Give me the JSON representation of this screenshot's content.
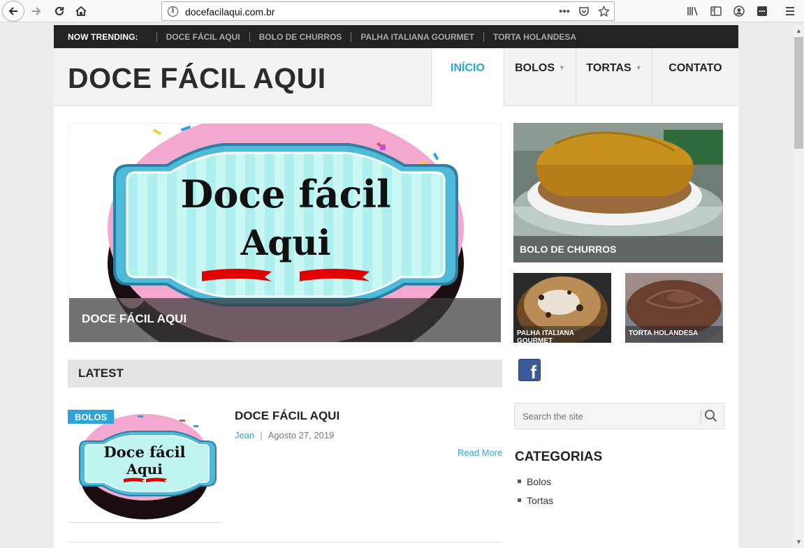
{
  "browser": {
    "url": "docefacilaqui.com.br"
  },
  "trending": {
    "label": "NOW TRENDING:",
    "links": [
      "DOCE FÁCIL AQUI",
      "BOLO DE CHURROS",
      "PALHA ITALIANA GOURMET",
      "TORTA HOLANDESA"
    ]
  },
  "site": {
    "title": "DOCE FÁCIL AQUI"
  },
  "nav": {
    "items": [
      {
        "label": "INÍCIO"
      },
      {
        "label": "BOLOS"
      },
      {
        "label": "TORTAS"
      },
      {
        "label": "CONTATO"
      }
    ]
  },
  "hero": {
    "logo_line1": "Doce fácil",
    "logo_line2": "Aqui",
    "caption": "DOCE FÁCIL AQUI"
  },
  "featured": {
    "big_caption": "BOLO DE CHURROS",
    "small1_caption": "PALHA ITALIANA GOURMET",
    "small2_caption": "TORTA HOLANDESA"
  },
  "latest": {
    "heading": "LATEST",
    "post": {
      "category": "BOLOS",
      "title": "DOCE FÁCIL AQUI",
      "author": "Jean",
      "date": "Agosto 27, 2019",
      "read_more": "Read More",
      "thumb_line1": "Doce fácil",
      "thumb_line2": "Aqui"
    }
  },
  "sidebar": {
    "search_placeholder": "Search the site",
    "categories_heading": "CATEGORIAS",
    "categories": [
      "Bolos",
      "Tortas"
    ]
  },
  "colors": {
    "accent": "#2ea3d8",
    "topbar": "#222222",
    "facebook": "#3b5998"
  }
}
